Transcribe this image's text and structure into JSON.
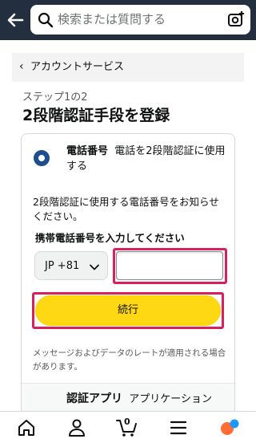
{
  "header": {
    "search_placeholder": "検索または質問する"
  },
  "breadcrumb": {
    "label": "アカウントサービス"
  },
  "step": "ステップ1の2",
  "title": "2段階認証手段を登録",
  "option_phone": {
    "title": "電話番号",
    "subtitle": "電話を2段階認証に使用する",
    "description": "2段階認証に使用する電話番号をお知らせください。",
    "field_label": "携帯電話番号を入力してください",
    "country_code": "JP +81",
    "phone_value": "",
    "continue_label": "続行",
    "notice": "メッセージおよびデータのレートが適用される場合があります。"
  },
  "option_app": {
    "title": "認証アプリ",
    "subtitle": "アプリケーション"
  },
  "bottom_nav": {
    "cart_count": "0"
  },
  "colors": {
    "header_bg": "#232f3e",
    "button_yellow": "#ffd814",
    "highlight": "#d8215b",
    "radio_blue": "#1e4f8c"
  }
}
